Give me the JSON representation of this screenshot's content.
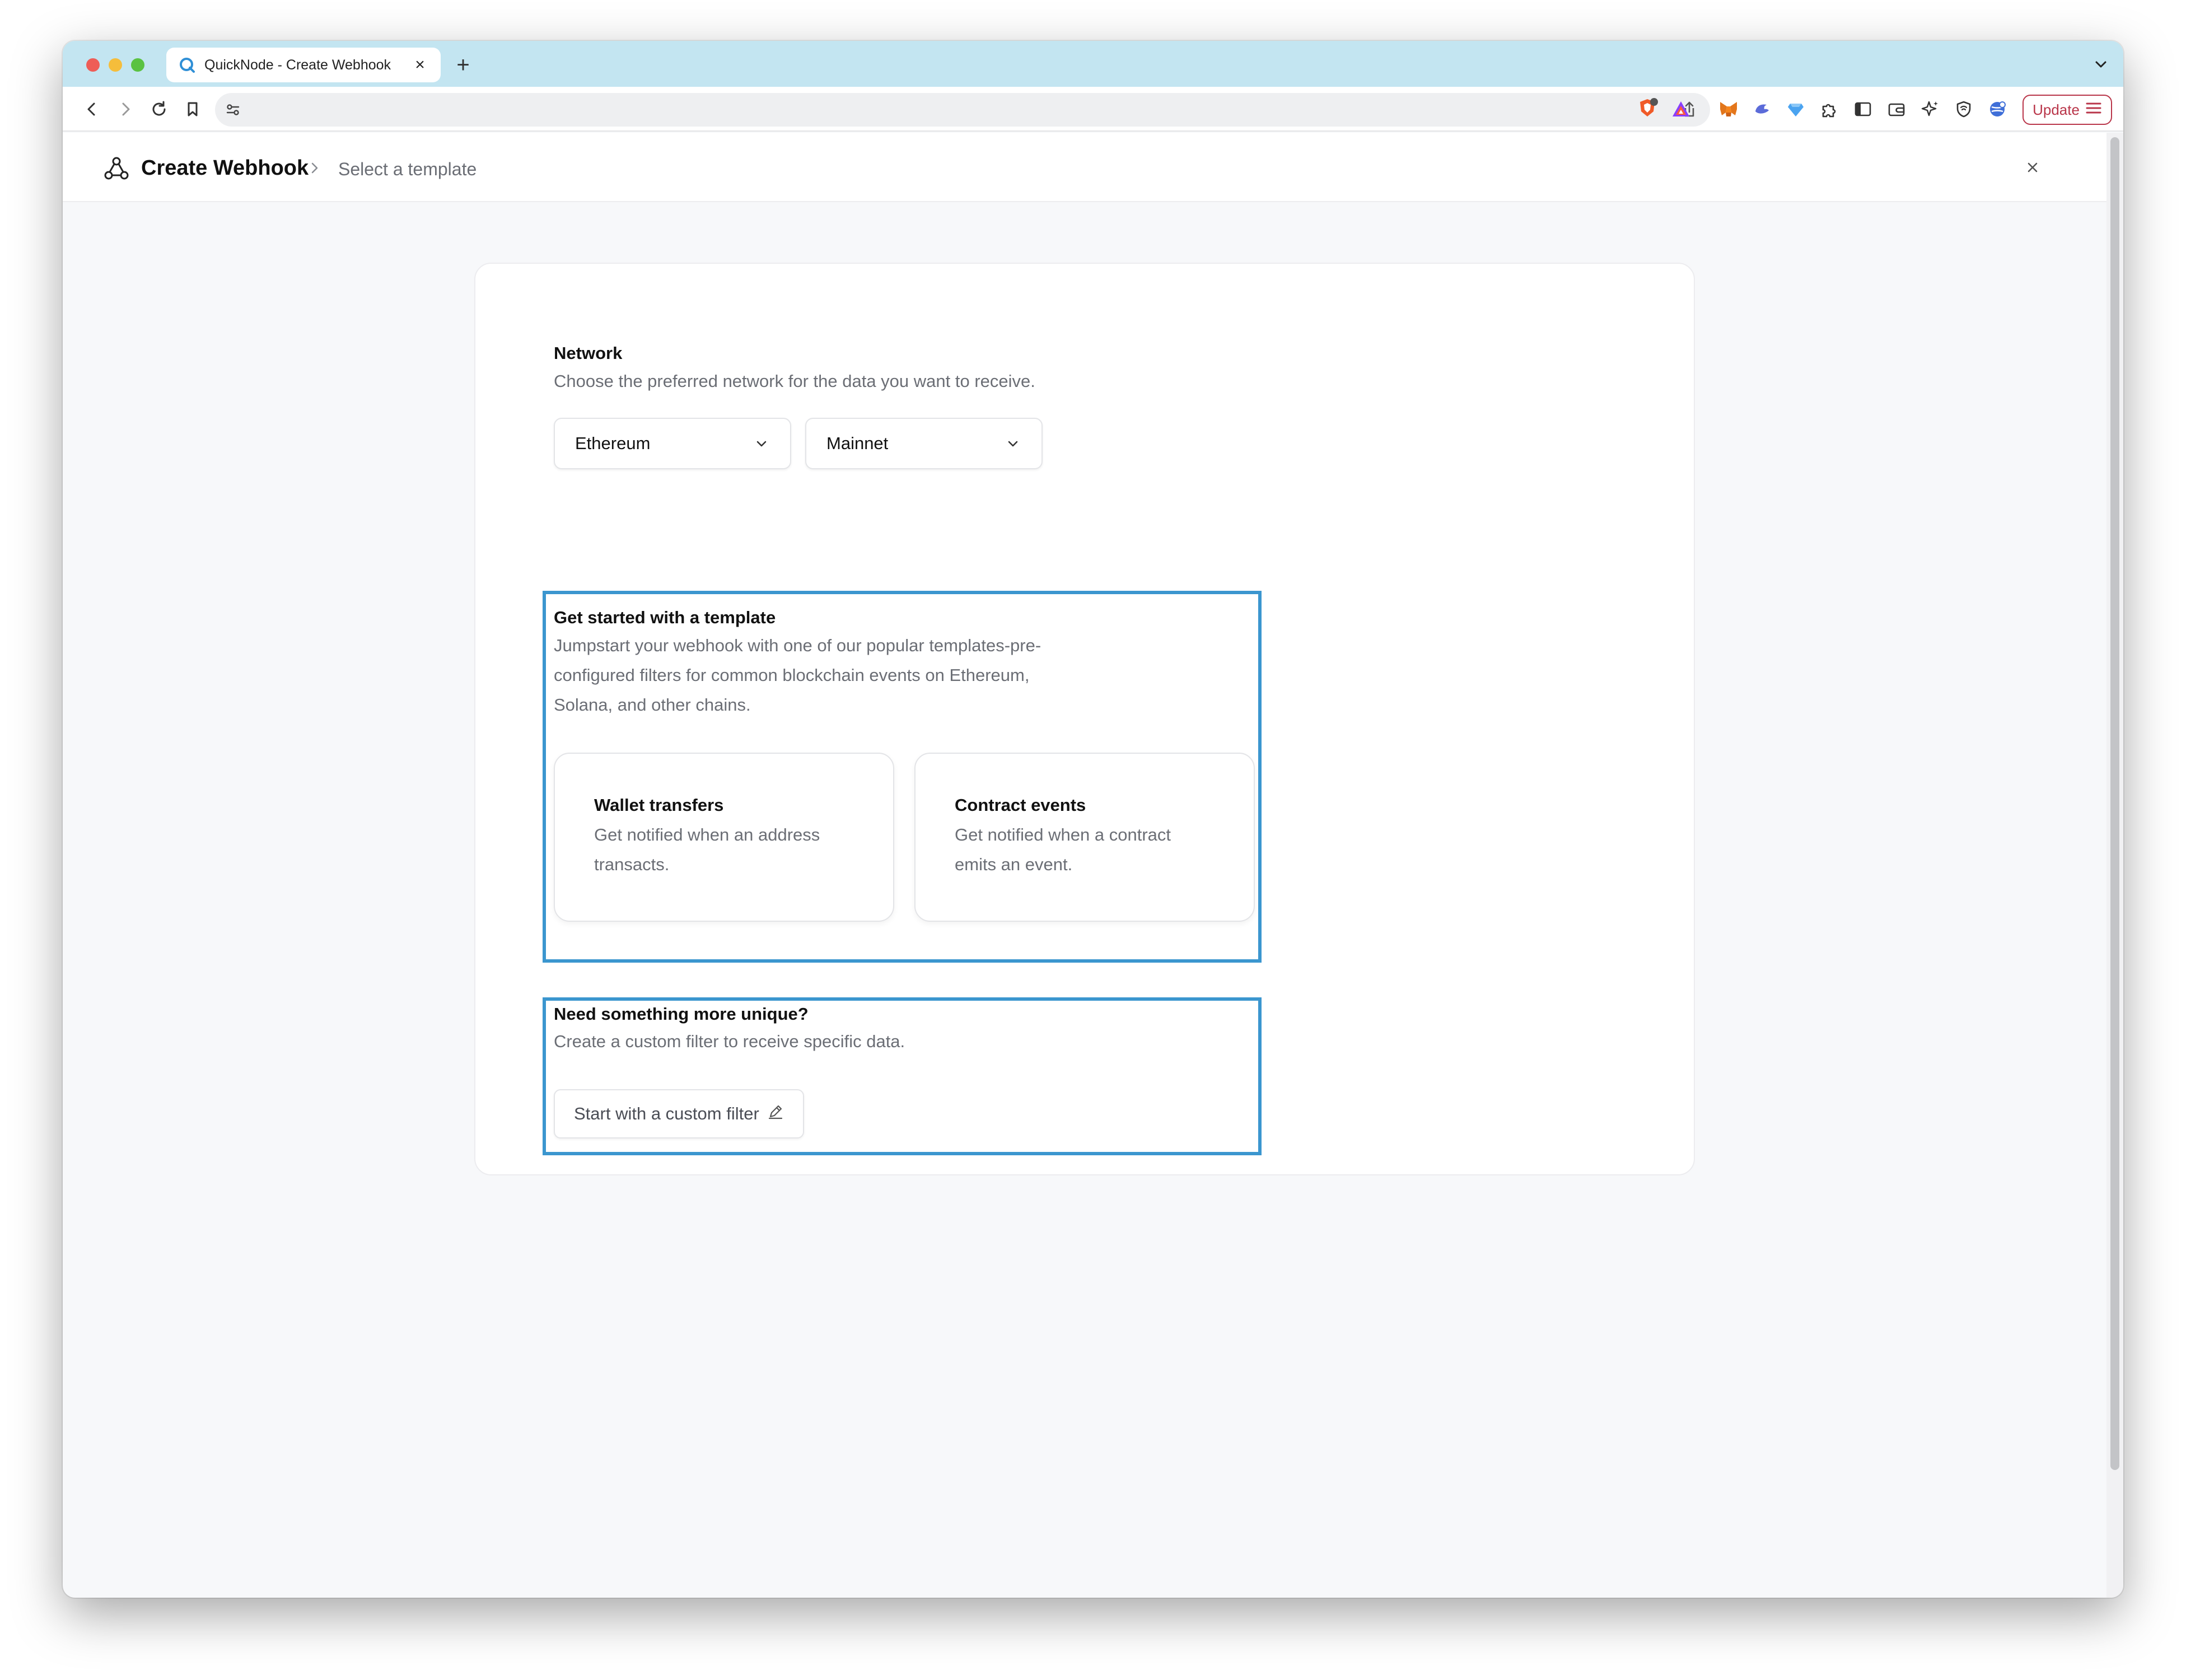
{
  "browser": {
    "tab_title": "QuickNode - Create Webhook",
    "tab_close": "×",
    "new_tab": "+",
    "update_label": "Update"
  },
  "page": {
    "title": "Create Webhook",
    "breadcrumb_sep": ">",
    "breadcrumb_current": "Select a template"
  },
  "network": {
    "title": "Network",
    "description": "Choose the preferred network for the data you want to receive.",
    "chain_selected": "Ethereum",
    "network_selected": "Mainnet"
  },
  "templates": {
    "title": "Get started with a template",
    "description_line1": "Jumpstart your webhook with one of our popular templates-pre-",
    "description_line2": "configured filters for common blockchain events on Ethereum,",
    "description_line3": "Solana, and other chains.",
    "items": [
      {
        "title": "Wallet transfers",
        "desc_line1": "Get notified when an address",
        "desc_line2": "transacts."
      },
      {
        "title": "Contract events",
        "desc_line1": "Get notified when a contract",
        "desc_line2": "emits an event."
      }
    ]
  },
  "custom": {
    "title": "Need something more unique?",
    "description": "Create a custom filter to receive specific data.",
    "button_label": "Start with a custom filter"
  },
  "colors": {
    "highlight": "#3b96cf",
    "tabstrip": "#c3e5f1",
    "update": "#b9364a"
  }
}
